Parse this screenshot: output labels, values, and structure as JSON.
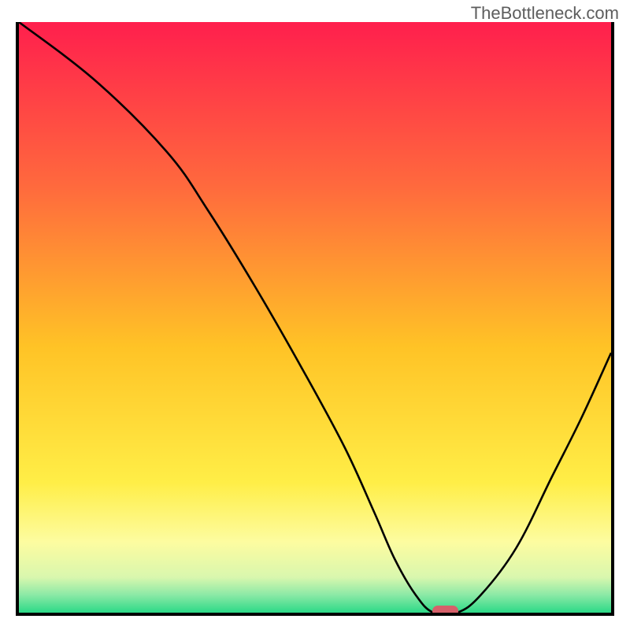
{
  "watermark": "TheBottleneck.com",
  "chart_data": {
    "type": "line",
    "title": "",
    "xlabel": "",
    "ylabel": "",
    "xlim": [
      0,
      100
    ],
    "ylim": [
      0,
      100
    ],
    "grid": false,
    "legend": false,
    "background": {
      "type": "vertical-gradient",
      "stops": [
        {
          "pos": 0.0,
          "color": "#ff1f4d"
        },
        {
          "pos": 0.28,
          "color": "#ff6a3d"
        },
        {
          "pos": 0.55,
          "color": "#ffc326"
        },
        {
          "pos": 0.78,
          "color": "#ffee47"
        },
        {
          "pos": 0.88,
          "color": "#fdfca0"
        },
        {
          "pos": 0.94,
          "color": "#d9f7ae"
        },
        {
          "pos": 0.97,
          "color": "#8be9a6"
        },
        {
          "pos": 1.0,
          "color": "#2cd987"
        }
      ]
    },
    "series": [
      {
        "name": "bottleneck-curve",
        "x": [
          0,
          13,
          25,
          32,
          40,
          48,
          55,
          60,
          63.5,
          67,
          70,
          74,
          78,
          84,
          90,
          95,
          100
        ],
        "y": [
          100,
          90,
          78,
          68,
          55,
          41,
          28,
          17,
          9,
          3,
          0,
          0,
          3,
          11,
          23,
          33,
          44
        ]
      }
    ],
    "marker": {
      "name": "optimal-point",
      "x_center": 72,
      "width_pct": 4.5,
      "y": 0,
      "color": "#d6606a"
    }
  }
}
